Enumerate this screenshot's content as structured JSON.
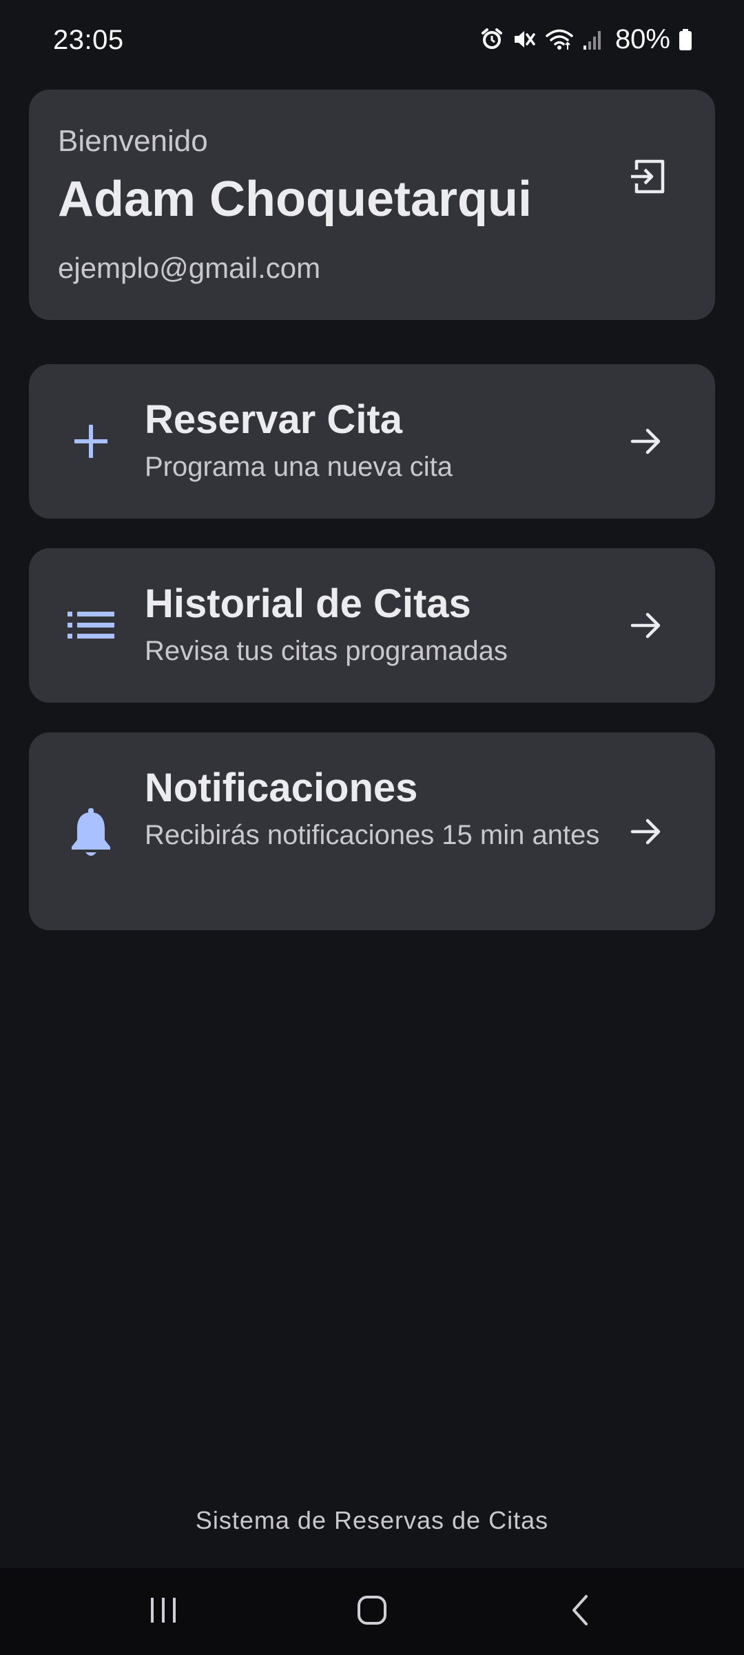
{
  "status_bar": {
    "time": "23:05",
    "battery": "80%",
    "icons": [
      "alarm-icon",
      "mute-icon",
      "wifi-icon",
      "signal-icon",
      "battery-icon"
    ]
  },
  "profile": {
    "welcome": "Bienvenido",
    "name": "Adam Choquetarqui",
    "email": "ejemplo@gmail.com",
    "logout_icon": "logout-icon"
  },
  "menu": {
    "items": [
      {
        "title": "Reservar Cita",
        "subtitle": "Programa una nueva cita",
        "icon": "plus-icon"
      },
      {
        "title": "Historial de Citas",
        "subtitle": "Revisa tus citas programadas",
        "icon": "list-icon"
      },
      {
        "title": "Notificaciones",
        "subtitle": "Recibirás notificaciones 15 min antes",
        "icon": "bell-icon"
      }
    ]
  },
  "footer": {
    "text": "Sistema de Reservas de Citas"
  },
  "nav": {
    "icons": [
      "recents-icon",
      "home-icon",
      "back-icon"
    ]
  },
  "colors": {
    "background": "#131418",
    "card": "#333439",
    "accent": "#a9c1ff",
    "text_primary": "#ececf0",
    "text_secondary": "#c8c8ce"
  }
}
